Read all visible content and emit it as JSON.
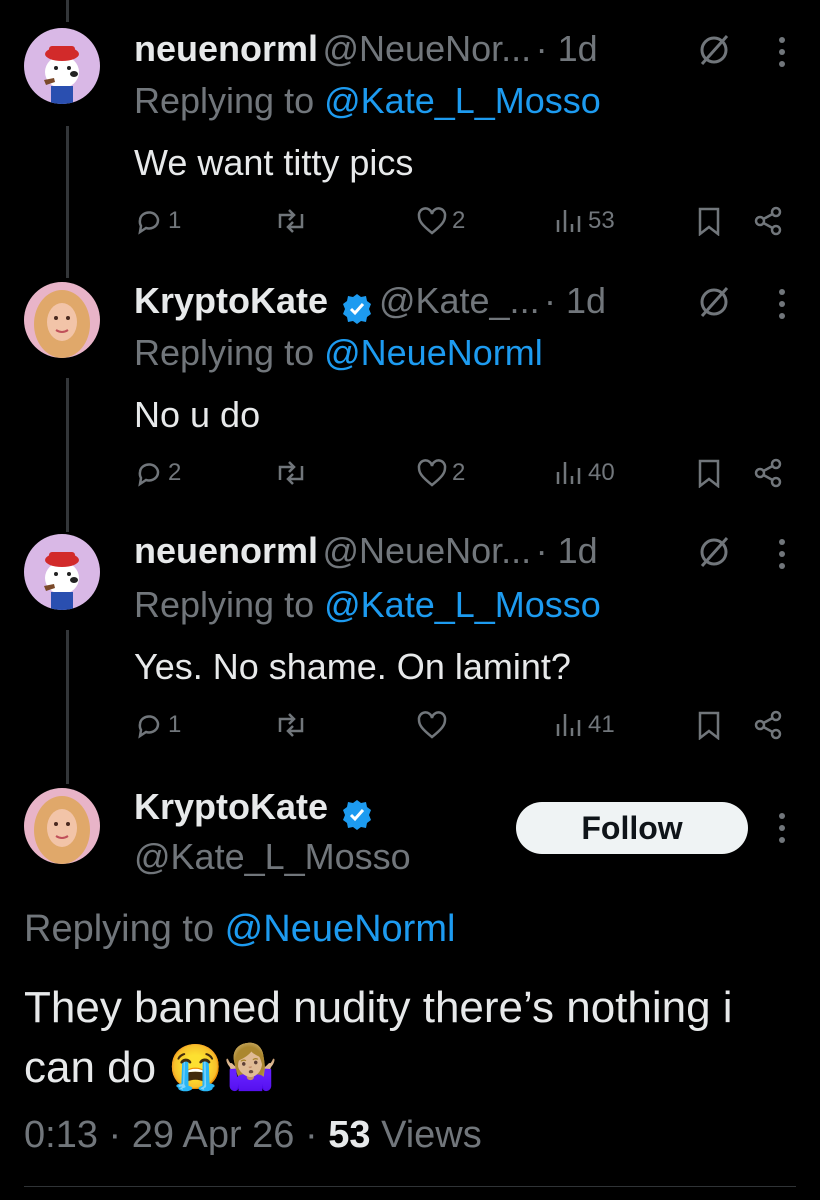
{
  "tweets": [
    {
      "name": "neuenorml",
      "handle": "@NeueNor...",
      "time": "· 1d",
      "replying_prefix": "Replying to ",
      "replying_to": "@Kate_L_Mosso",
      "text": "We want titty pics",
      "replies": "1",
      "retweets": "",
      "likes": "2",
      "views": "53"
    },
    {
      "name": "KryptoKate",
      "handle": "@Kate_...",
      "time": "· 1d",
      "replying_prefix": "Replying to ",
      "replying_to": "@NeueNorml",
      "text": "No u do",
      "replies": "2",
      "retweets": "",
      "likes": "2",
      "views": "40"
    },
    {
      "name": "neuenorml",
      "handle": "@NeueNor...",
      "time": "· 1d",
      "replying_prefix": "Replying to ",
      "replying_to": "@Kate_L_Mosso",
      "text": "Yes. No shame. On lamint?",
      "replies": "1",
      "retweets": "",
      "likes": "",
      "views": "41"
    }
  ],
  "main": {
    "name": "KryptoKate",
    "handle": "@Kate_L_Mosso",
    "follow_label": "Follow",
    "replying_prefix": "Replying to ",
    "replying_to": "@NeueNorml",
    "text": "They banned nudity there’s nothing i can do 😭🤷🏼‍♀️",
    "time": "0:13",
    "date": "29 Apr 26",
    "views_count": "53",
    "views_label": "Views"
  },
  "colors": {
    "background": "#000000",
    "text": "#e7e9ea",
    "muted": "#71767b",
    "link": "#1d9bf0",
    "verified": "#1d9bf0"
  },
  "icons": [
    "reply-icon",
    "retweet-icon",
    "like-icon",
    "views-icon",
    "bookmark-icon",
    "share-icon",
    "more-icon",
    "verified-icon",
    "grok-icon"
  ]
}
